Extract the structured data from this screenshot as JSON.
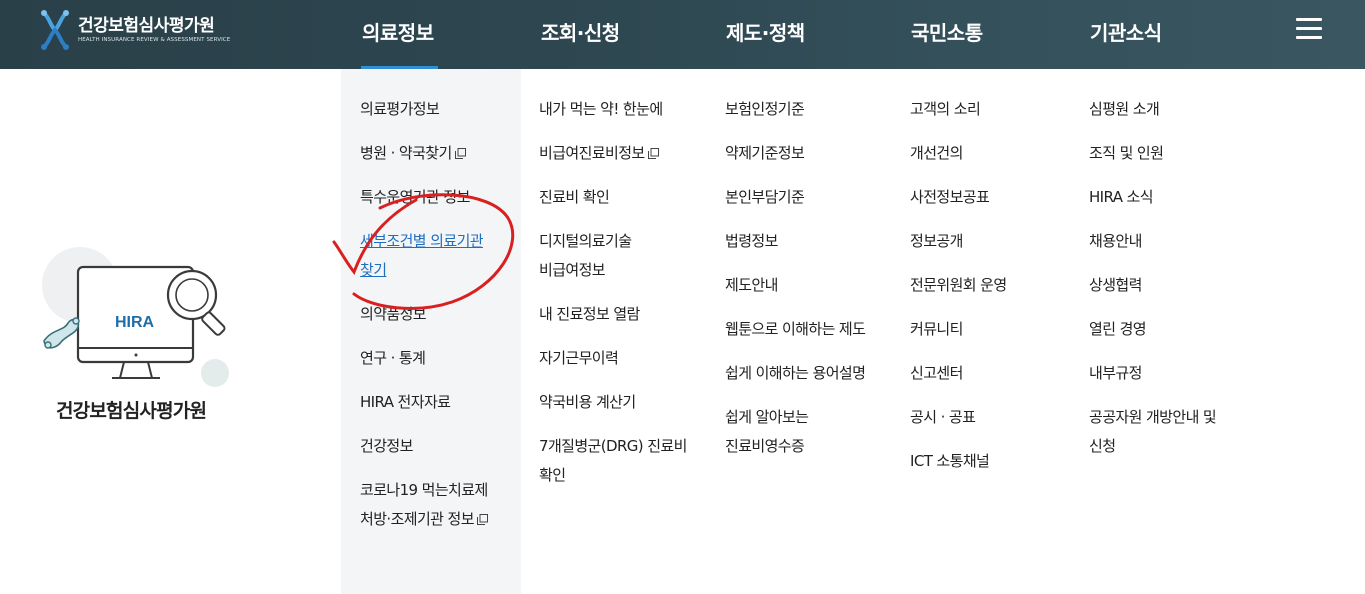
{
  "header": {
    "logo_ko": "건강보험심사평가원",
    "logo_en": "HEALTH INSURANCE REVIEW & ASSESSMENT SERVICE",
    "nav": [
      "의료정보",
      "조회·신청",
      "제도·정책",
      "국민소통",
      "기관소식"
    ],
    "active_nav": "의료정보",
    "menu_icon": "hamburger-icon",
    "accent_color": "#2f8fd6"
  },
  "brand": {
    "illustration_text": "HIRA",
    "label": "건강보험심사평가원"
  },
  "columns": [
    {
      "items": [
        {
          "label": "의료평가정보"
        },
        {
          "label": "병원 · 약국찾기",
          "external": true
        },
        {
          "label": "특수운영기관 정보"
        },
        {
          "label": "세부조건별 의료기관",
          "label2": "찾기",
          "highlighted": true
        },
        {
          "label": "의약품정보"
        },
        {
          "label": "연구 · 통계"
        },
        {
          "label": "HIRA 전자자료"
        },
        {
          "label": "건강정보"
        },
        {
          "label": "코로나19 먹는치료제",
          "label2": "처방·조제기관 정보",
          "external": true
        }
      ]
    },
    {
      "items": [
        {
          "label": "내가 먹는 약! 한눈에"
        },
        {
          "label": "비급여진료비정보",
          "external": true
        },
        {
          "label": "진료비 확인"
        },
        {
          "label": "디지털의료기술",
          "label2": "비급여정보"
        },
        {
          "label": "내 진료정보 열람"
        },
        {
          "label": "자기근무이력"
        },
        {
          "label": "약국비용 계산기"
        },
        {
          "label": "7개질병군(DRG) 진료비",
          "label2": "확인"
        }
      ]
    },
    {
      "items": [
        {
          "label": "보험인정기준"
        },
        {
          "label": "약제기준정보"
        },
        {
          "label": "본인부담기준"
        },
        {
          "label": "법령정보"
        },
        {
          "label": "제도안내"
        },
        {
          "label": "웹툰으로 이해하는 제도"
        },
        {
          "label": "쉽게 이해하는 용어설명"
        },
        {
          "label": "쉽게 알아보는",
          "label2": "진료비영수증"
        }
      ]
    },
    {
      "items": [
        {
          "label": "고객의 소리"
        },
        {
          "label": "개선건의"
        },
        {
          "label": "사전정보공표"
        },
        {
          "label": "정보공개"
        },
        {
          "label": "전문위원회 운영"
        },
        {
          "label": "커뮤니티"
        },
        {
          "label": "신고센터"
        },
        {
          "label": "공시 · 공표"
        },
        {
          "label": "ICT 소통채널"
        }
      ]
    },
    {
      "items": [
        {
          "label": "심평원 소개"
        },
        {
          "label": "조직 및 인원"
        },
        {
          "label": "HIRA 소식"
        },
        {
          "label": "채용안내"
        },
        {
          "label": "상생협력"
        },
        {
          "label": "열린 경영"
        },
        {
          "label": "내부규정"
        },
        {
          "label": "공공자원 개방안내 및",
          "label2": "신청"
        }
      ]
    }
  ],
  "annotation_color": "#d92020"
}
